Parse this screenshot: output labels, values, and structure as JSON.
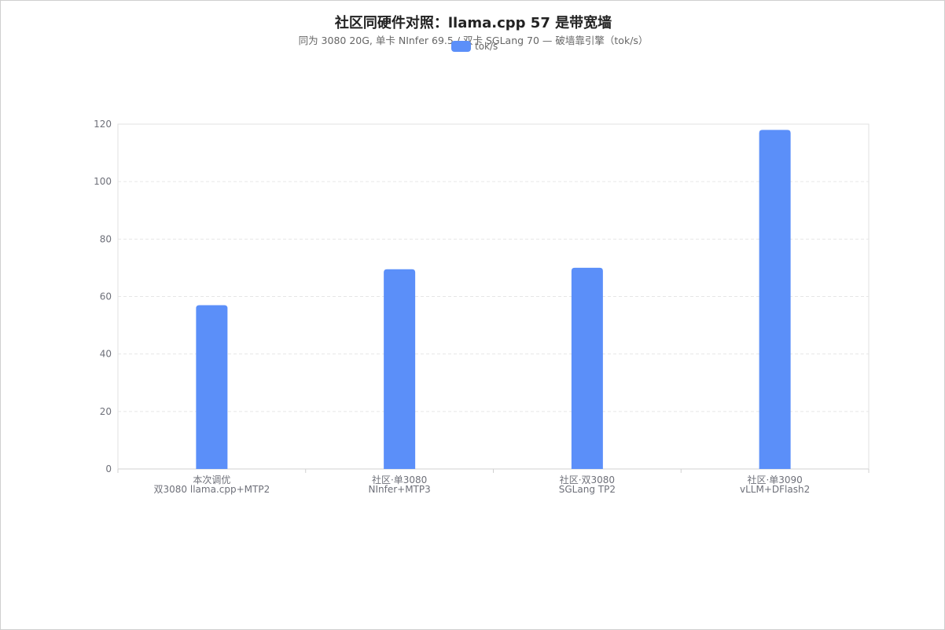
{
  "chart_data": {
    "type": "bar",
    "title": "社区同硬件对照：llama.cpp 57 是带宽墙",
    "subtitle": "同为 3080 20G, 单卡 NInfer 69.5 / 双卡 SGLang 70 — 破墙靠引擎（tok/s）",
    "legend": [
      "tok/s"
    ],
    "legend_position": "top-center",
    "categories": [
      [
        "本次调优",
        "双3080 llama.cpp+MTP2"
      ],
      [
        "社区·单3080",
        "NInfer+MTP3"
      ],
      [
        "社区·双3080",
        "SGLang TP2"
      ],
      [
        "社区·单3090",
        "vLLM+DFlash2"
      ]
    ],
    "series": [
      {
        "name": "tok/s",
        "values": [
          57,
          69.5,
          70,
          118
        ]
      }
    ],
    "ylim": [
      0,
      120
    ],
    "yticks": [
      0,
      20,
      40,
      60,
      80,
      100,
      120
    ],
    "grid": true,
    "color": "#5b8ff9"
  }
}
